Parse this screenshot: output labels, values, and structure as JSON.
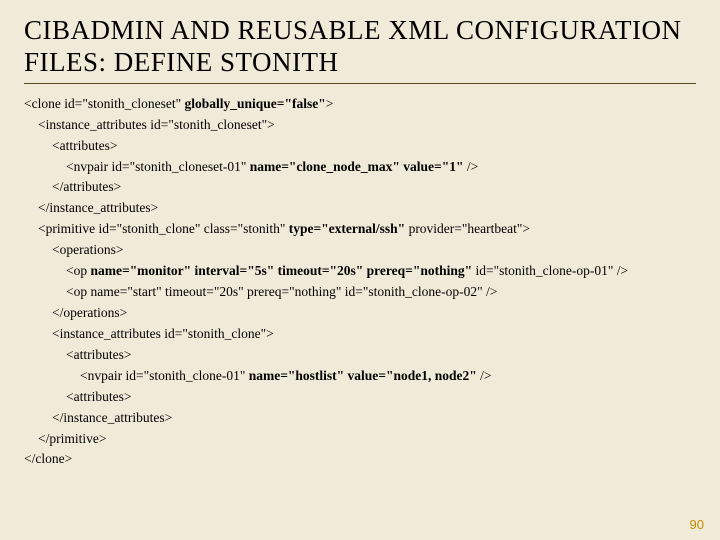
{
  "title": "CIBADMIN AND REUSABLE XML CONFIGURATION FILES: DEFINE STONITH",
  "lines": [
    {
      "indent": 0,
      "parts": [
        {
          "t": "<clone id=\"stonith_cloneset\" "
        },
        {
          "t": "globally_unique=\"false\"",
          "b": true
        },
        {
          "t": ">"
        }
      ]
    },
    {
      "indent": 1,
      "parts": [
        {
          "t": "<instance_attributes id=\"stonith_cloneset\">"
        }
      ]
    },
    {
      "indent": 2,
      "parts": [
        {
          "t": "<attributes>"
        }
      ]
    },
    {
      "indent": 3,
      "parts": [
        {
          "t": "<nvpair id=\"stonith_cloneset-01\" "
        },
        {
          "t": "name=\"clone_node_max\" value=\"1\"",
          "b": true
        },
        {
          "t": " />"
        }
      ]
    },
    {
      "indent": 2,
      "parts": [
        {
          "t": "</attributes>"
        }
      ]
    },
    {
      "indent": 1,
      "parts": [
        {
          "t": "</instance_attributes>"
        }
      ]
    },
    {
      "indent": 1,
      "parts": [
        {
          "t": "<primitive id=\"stonith_clone\" class=\"stonith\" "
        },
        {
          "t": "type=\"external/ssh\"",
          "b": true
        },
        {
          "t": " provider=\"heartbeat\">"
        }
      ]
    },
    {
      "indent": 2,
      "parts": [
        {
          "t": "<operations>"
        }
      ]
    },
    {
      "indent": 3,
      "parts": [
        {
          "t": "<op "
        },
        {
          "t": "name=\"monitor\" interval=\"5s\" timeout=\"20s\" prereq=\"nothing\"",
          "b": true
        },
        {
          "t": " id=\"stonith_clone-op-01\" />"
        }
      ]
    },
    {
      "indent": 3,
      "parts": [
        {
          "t": "<op name=\"start\" timeout=\"20s\" prereq=\"nothing\" id=\"stonith_clone-op-02\" />"
        }
      ]
    },
    {
      "indent": 2,
      "parts": [
        {
          "t": "</operations>"
        }
      ]
    },
    {
      "indent": 2,
      "parts": [
        {
          "t": "<instance_attributes id=\"stonith_clone\">"
        }
      ]
    },
    {
      "indent": 3,
      "parts": [
        {
          "t": "<attributes>"
        }
      ]
    },
    {
      "indent": 4,
      "parts": [
        {
          "t": "<nvpair id=\"stonith_clone-01\" "
        },
        {
          "t": "name=\"hostlist\" value=\"node1, node2\"",
          "b": true
        },
        {
          "t": " />"
        }
      ]
    },
    {
      "indent": 3,
      "parts": [
        {
          "t": "<attributes>"
        }
      ]
    },
    {
      "indent": 2,
      "parts": [
        {
          "t": "</instance_attributes>"
        }
      ]
    },
    {
      "indent": 1,
      "parts": [
        {
          "t": "</primitive>"
        }
      ]
    },
    {
      "indent": 0,
      "parts": [
        {
          "t": "</clone>"
        }
      ]
    }
  ],
  "page": "90"
}
